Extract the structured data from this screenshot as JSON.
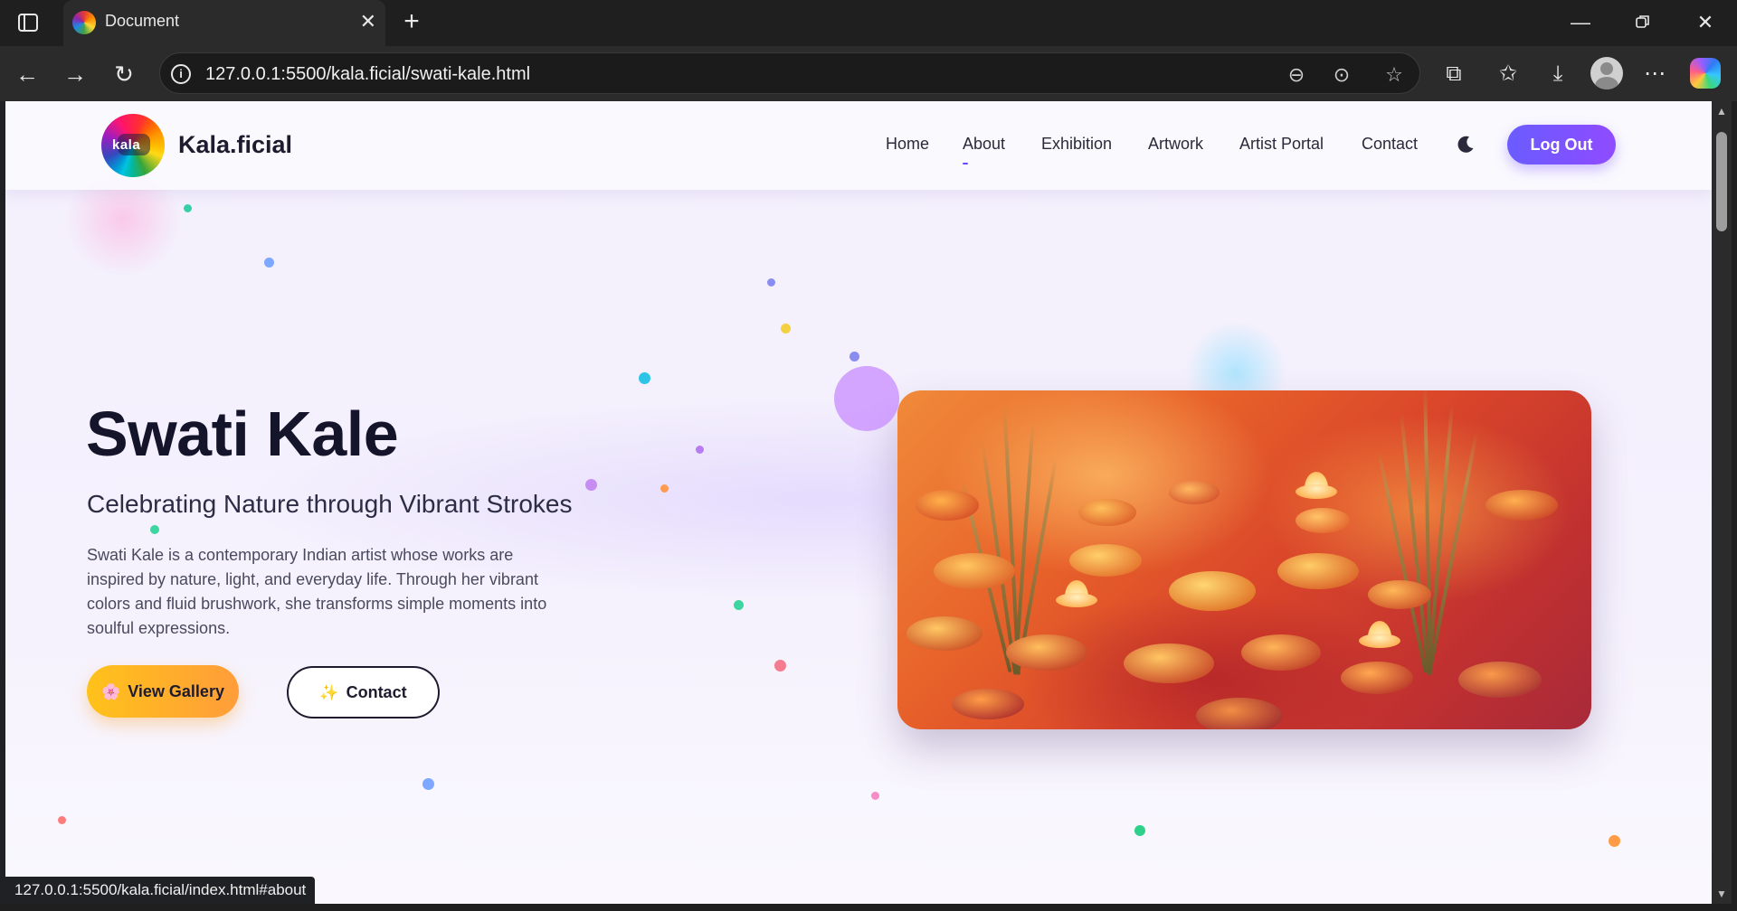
{
  "browser": {
    "tab_title": "Document",
    "url": "127.0.0.1:5500/kala.ficial/swati-kale.html",
    "status_url": "127.0.0.1:5500/kala.ficial/index.html#about"
  },
  "site": {
    "logo_text": "kala",
    "brand": "Kala.ficial",
    "nav": [
      {
        "label": "Home"
      },
      {
        "label": "About"
      },
      {
        "label": "Exhibition"
      },
      {
        "label": "Artwork"
      },
      {
        "label": "Artist Portal"
      },
      {
        "label": "Contact"
      }
    ],
    "logout_label": "Log Out",
    "theme_toggle_icon": "moon-icon",
    "accent": "#7b4dff"
  },
  "hero": {
    "title": "Swati Kale",
    "subtitle": "Celebrating Nature through Vibrant Strokes",
    "description": "Swati Kale is a contemporary Indian artist whose works are inspired by nature, light, and everyday life. Through her vibrant colors and fluid brushwork, she transforms simple moments into soulful expressions.",
    "gallery_icon": "🌸",
    "gallery_label": "View Gallery",
    "contact_icon": "✨",
    "contact_label": "Contact",
    "painting": "water-lilies-painting"
  }
}
